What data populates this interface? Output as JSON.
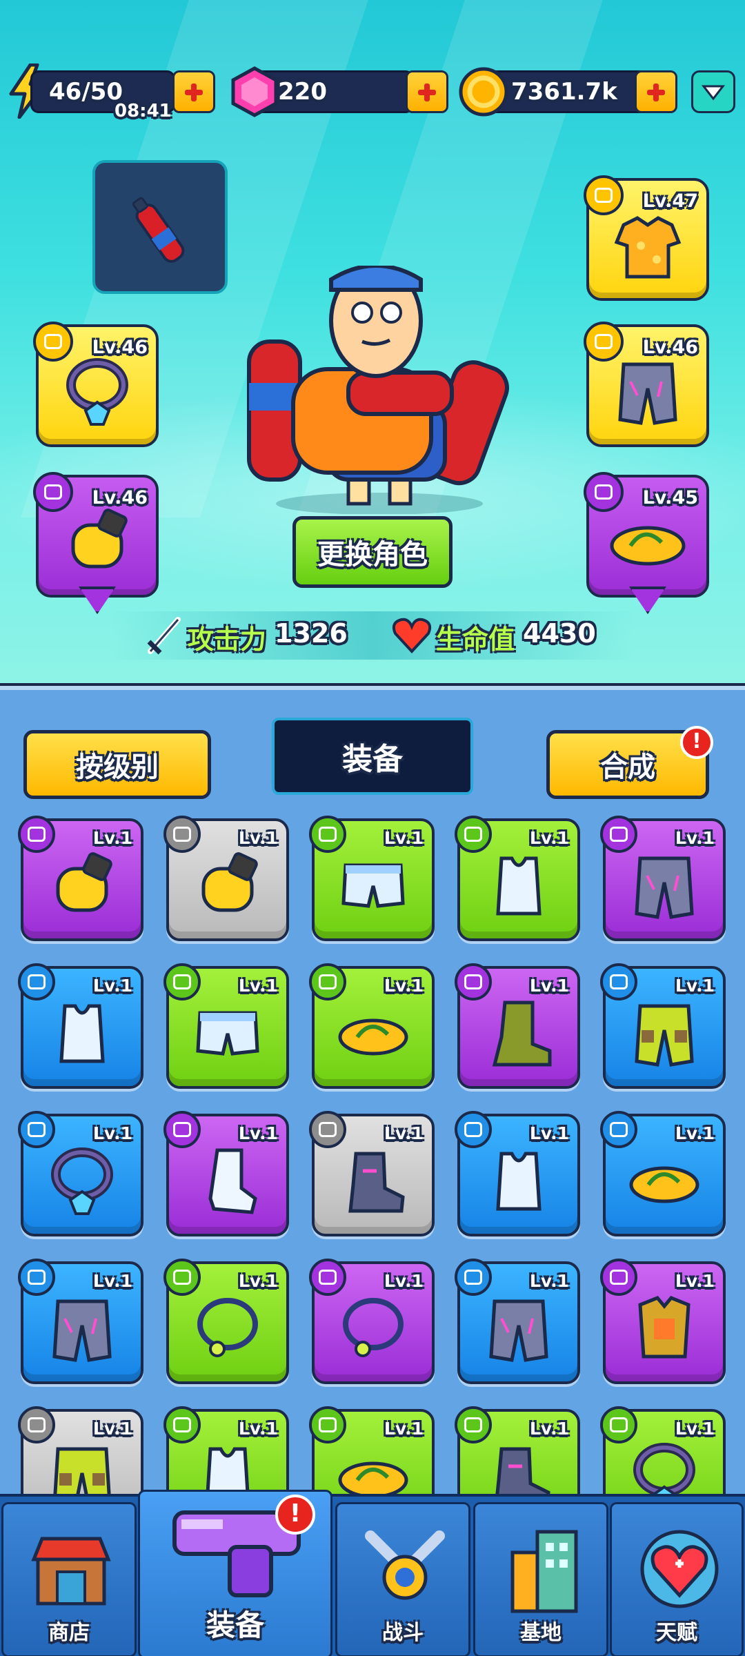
{
  "resources": {
    "energy": "46/50",
    "energy_timer": "08:41",
    "gems": "220",
    "coins": "7361.7k"
  },
  "hero": {
    "change_character_label": "更换角色",
    "attack_label": "攻击力",
    "attack_value": "1326",
    "hp_label": "生命值",
    "hp_value": "4430",
    "slots": {
      "necklace": "Lv.46",
      "gloves": "Lv.46",
      "shirt": "Lv.47",
      "pants": "Lv.46",
      "shoes": "Lv.45"
    }
  },
  "panel": {
    "sort_button": "按级别",
    "title": "装备",
    "merge_button": "合成",
    "merge_alert": "!"
  },
  "inventory": [
    {
      "name": "gloves",
      "rarity": "purple",
      "lv": "Lv.1"
    },
    {
      "name": "gloves",
      "rarity": "gray",
      "lv": "Lv.1"
    },
    {
      "name": "shorts",
      "rarity": "green",
      "lv": "Lv.1"
    },
    {
      "name": "tank-top",
      "rarity": "green",
      "lv": "Lv.1"
    },
    {
      "name": "armored-pants",
      "rarity": "purple",
      "lv": "Lv.1"
    },
    {
      "name": "tank-top",
      "rarity": "blue",
      "lv": "Lv.1"
    },
    {
      "name": "shorts",
      "rarity": "green",
      "lv": "Lv.1"
    },
    {
      "name": "flip-flops",
      "rarity": "green",
      "lv": "Lv.1"
    },
    {
      "name": "boots",
      "rarity": "purple",
      "lv": "Lv.1"
    },
    {
      "name": "cargo-pants",
      "rarity": "blue",
      "lv": "Lv.1"
    },
    {
      "name": "necklace",
      "rarity": "blue",
      "lv": "Lv.1"
    },
    {
      "name": "sock",
      "rarity": "purple",
      "lv": "Lv.1"
    },
    {
      "name": "armored-boots",
      "rarity": "gray",
      "lv": "Lv.1"
    },
    {
      "name": "tank-top",
      "rarity": "blue",
      "lv": "Lv.1"
    },
    {
      "name": "flip-flops",
      "rarity": "blue",
      "lv": "Lv.1"
    },
    {
      "name": "armored-pants",
      "rarity": "blue",
      "lv": "Lv.1"
    },
    {
      "name": "ring-necklace",
      "rarity": "green",
      "lv": "Lv.1"
    },
    {
      "name": "ring-necklace",
      "rarity": "purple",
      "lv": "Lv.1"
    },
    {
      "name": "armored-pants",
      "rarity": "blue",
      "lv": "Lv.1"
    },
    {
      "name": "chest-armor",
      "rarity": "purple",
      "lv": "Lv.1"
    },
    {
      "name": "cargo-pants",
      "rarity": "gray",
      "lv": "Lv.1"
    },
    {
      "name": "tank-top",
      "rarity": "green",
      "lv": "Lv.1"
    },
    {
      "name": "flip-flops",
      "rarity": "green",
      "lv": "Lv.1"
    },
    {
      "name": "armored-boots",
      "rarity": "green",
      "lv": "Lv.1"
    },
    {
      "name": "necklace",
      "rarity": "green",
      "lv": "Lv.1"
    }
  ],
  "nav": {
    "shop": "商店",
    "equipment": "装备",
    "equipment_alert": "!",
    "battle": "战斗",
    "base": "基地",
    "talent": "天赋"
  },
  "colors": {
    "hero_bg": "#3fe0e0",
    "panel_bg": "#62a4e4",
    "gold": "#ffd40d",
    "purple": "#9b2ed6",
    "green": "#6fd012",
    "blue": "#1683e6",
    "gray": "#b9b9b9"
  }
}
